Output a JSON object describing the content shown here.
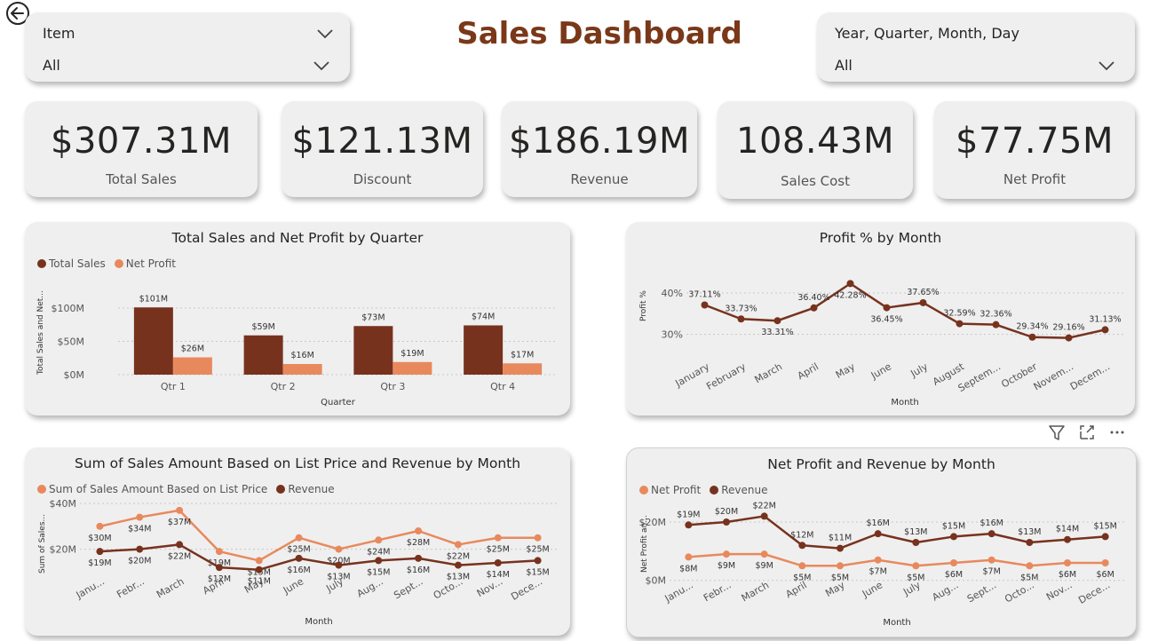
{
  "colors": {
    "dark": "#77321e",
    "light": "#e8895d",
    "title": "#7a3819"
  },
  "header": {
    "title": "Sales Dashboard"
  },
  "slicers": [
    {
      "label": "Item",
      "value": "All"
    },
    {
      "label": "Year, Quarter, Month, Day",
      "value": "All"
    }
  ],
  "kpis": [
    {
      "value": "$307.31M",
      "label": "Total Sales"
    },
    {
      "value": "$121.13M",
      "label": "Discount"
    },
    {
      "value": "$186.19M",
      "label": "Revenue"
    },
    {
      "value": "108.43M",
      "label": "Sales Cost"
    },
    {
      "value": "$77.75M",
      "label": "Net Profit"
    }
  ],
  "visual_header_icons": [
    "filter-icon",
    "focus-mode-icon",
    "more-options-icon"
  ],
  "chart_data": [
    {
      "type": "bar",
      "title": "Total Sales and Net Profit by Quarter",
      "xlabel": "Quarter",
      "ylabel": "Total Sales and Net...",
      "categories": [
        "Qtr 1",
        "Qtr 2",
        "Qtr 3",
        "Qtr 4"
      ],
      "yticks": [
        "$0M",
        "$50M",
        "$100M"
      ],
      "ylim": [
        0,
        120
      ],
      "legend": "top-left",
      "series": [
        {
          "name": "Total Sales",
          "values": [
            101,
            59,
            73,
            74
          ],
          "labels": [
            "$101M",
            "$59M",
            "$73M",
            "$74M"
          ],
          "color": "#77321e"
        },
        {
          "name": "Net Profit",
          "values": [
            26,
            16,
            19,
            17
          ],
          "labels": [
            "$26M",
            "$16M",
            "$19M",
            "$17M"
          ],
          "color": "#e8895d"
        }
      ]
    },
    {
      "type": "line",
      "title": "Profit % by Month",
      "xlabel": "Month",
      "ylabel": "Profit %",
      "categories": [
        "January",
        "February",
        "March",
        "April",
        "May",
        "June",
        "July",
        "August",
        "Septem...",
        "October",
        "Novem...",
        "Decem..."
      ],
      "yticks": [
        "30%",
        "40%"
      ],
      "ylim": [
        25,
        46
      ],
      "series": [
        {
          "name": "Profit %",
          "values": [
            37.11,
            33.73,
            33.31,
            36.4,
            42.28,
            36.45,
            37.65,
            32.59,
            32.36,
            29.34,
            29.16,
            31.13
          ],
          "labels": [
            "37.11%",
            "33.73%",
            "33.31%",
            "36.40%",
            "42.28%",
            "36.45%",
            "37.65%",
            "32.59%",
            "32.36%",
            "29.34%",
            "29.16%",
            "31.13%"
          ],
          "color": "#77321e"
        }
      ]
    },
    {
      "type": "line",
      "title": "Sum of Sales Amount Based on List Price and Revenue by Month",
      "xlabel": "Month",
      "ylabel": "Sum of Sales...",
      "categories": [
        "Janu...",
        "Febr...",
        "March",
        "April",
        "May",
        "June",
        "July",
        "Aug...",
        "Sept...",
        "Octo...",
        "Nov...",
        "Dece..."
      ],
      "yticks": [
        "$20M",
        "$40M"
      ],
      "ylim": [
        7,
        42
      ],
      "legend": "top-left",
      "series": [
        {
          "name": "Sum of Sales Amount Based on List Price",
          "values": [
            30,
            34,
            37,
            19,
            15,
            25,
            20,
            24,
            28,
            22,
            25,
            25
          ],
          "labels": [
            "$30M",
            "$34M",
            "$37M",
            "$19M",
            "$15M",
            "$25M",
            "$20M",
            "$24M",
            "$28M",
            "$22M",
            "$25M",
            "$25M"
          ],
          "color": "#e8895d"
        },
        {
          "name": "Revenue",
          "values": [
            19,
            20,
            22,
            12,
            11,
            16,
            13,
            15,
            16,
            13,
            14,
            15
          ],
          "labels": [
            "$19M",
            "$20M",
            "$22M",
            "$12M",
            "$11M",
            "$16M",
            "$13M",
            "$15M",
            "$16M",
            "$13M",
            "$14M",
            "$15M"
          ],
          "color": "#77321e"
        }
      ]
    },
    {
      "type": "line",
      "title": "Net Profit and Revenue by Month",
      "xlabel": "Month",
      "ylabel": "Net Profit an...",
      "categories": [
        "Janu...",
        "Febr...",
        "March",
        "April",
        "May",
        "June",
        "July",
        "Aug...",
        "Sept...",
        "Octo...",
        "Nov...",
        "Dece..."
      ],
      "yticks": [
        "$0M",
        "$20M"
      ],
      "ylim": [
        -1,
        27
      ],
      "legend": "top-left",
      "series": [
        {
          "name": "Net Profit",
          "values": [
            8,
            9,
            9,
            5,
            5,
            7,
            5,
            6,
            7,
            5,
            6,
            6
          ],
          "labels": [
            "$8M",
            "$9M",
            "$9M",
            "$5M",
            "$5M",
            "$7M",
            "$5M",
            "$6M",
            "$7M",
            "$5M",
            "$6M",
            "$6M"
          ],
          "color": "#e8895d"
        },
        {
          "name": "Revenue",
          "values": [
            19,
            20,
            22,
            12,
            11,
            16,
            13,
            15,
            16,
            13,
            14,
            15
          ],
          "labels": [
            "$19M",
            "$20M",
            "$22M",
            "$12M",
            "$11M",
            "$16M",
            "$13M",
            "$15M",
            "$16M",
            "$13M",
            "$14M",
            "$15M"
          ],
          "color": "#77321e"
        }
      ]
    }
  ]
}
